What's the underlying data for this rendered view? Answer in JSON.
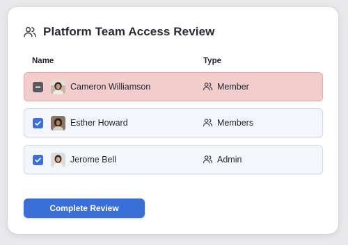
{
  "header": {
    "icon": "users-icon",
    "title": "Platform Team Access Review"
  },
  "table": {
    "columns": [
      "Name",
      "Type"
    ],
    "rows": [
      {
        "name": "Cameron Williamson",
        "type": "Member",
        "checkbox_state": "indeterminate",
        "type_icon": "users-icon",
        "highlight_color": "#f3cccc"
      },
      {
        "name": "Esther Howard",
        "type": "Members",
        "checkbox_state": "checked",
        "type_icon": "users-icon",
        "highlight_color": "#f3f6fb"
      },
      {
        "name": "Jerome Bell",
        "type": "Admin",
        "checkbox_state": "checked",
        "type_icon": "users-icon",
        "highlight_color": "#f3f6fb"
      }
    ]
  },
  "actions": {
    "complete_label": "Complete Review"
  },
  "colors": {
    "accent": "#3a6fd8",
    "selected_row": "#f3cccc",
    "indeterminate_checkbox": "#5a5a5e"
  }
}
